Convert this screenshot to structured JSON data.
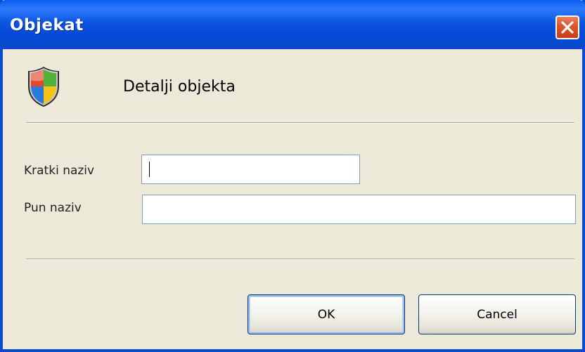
{
  "window": {
    "title": "Objekat",
    "close_icon": "close-icon"
  },
  "header": {
    "icon": "security-shield-icon",
    "title": "Detalji objekta"
  },
  "form": {
    "short_name_label": "Kratki naziv",
    "short_name_value": "",
    "full_name_label": "Pun naziv",
    "full_name_value": ""
  },
  "buttons": {
    "ok_label": "OK",
    "cancel_label": "Cancel"
  },
  "colors": {
    "titlebar": "#0A49C9",
    "window_bg": "#ECE9D8",
    "close_button": "#E0562C",
    "field_border": "#7F9DB9",
    "button_border": "#003C74"
  }
}
